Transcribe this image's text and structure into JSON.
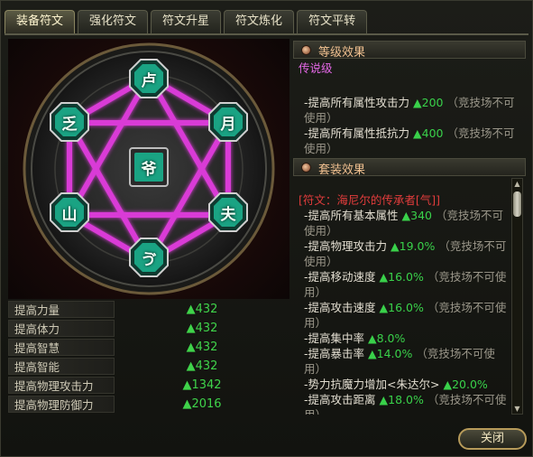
{
  "window": {
    "title": "符文"
  },
  "tabs": [
    {
      "label": "装备符文",
      "active": true
    },
    {
      "label": "强化符文",
      "active": false
    },
    {
      "label": "符文升星",
      "active": false
    },
    {
      "label": "符文炼化",
      "active": false
    },
    {
      "label": "符文平转",
      "active": false
    }
  ],
  "runes": [
    {
      "glyph": "卢"
    },
    {
      "glyph": "月"
    },
    {
      "glyph": "夫"
    },
    {
      "glyph": "ゔ"
    },
    {
      "glyph": "山"
    },
    {
      "glyph": "乏"
    },
    {
      "glyph": "爷"
    }
  ],
  "stats": [
    {
      "name": "提高力量",
      "value": "▲432"
    },
    {
      "name": "提高体力",
      "value": "▲432"
    },
    {
      "name": "提高智慧",
      "value": "▲432"
    },
    {
      "name": "提高智能",
      "value": "▲432"
    },
    {
      "name": "提高物理攻击力",
      "value": "▲1342"
    },
    {
      "name": "提高物理防御力",
      "value": "▲2016"
    }
  ],
  "level_panel": {
    "title": "等级效果",
    "grade": "传说级",
    "lines": [
      {
        "text": "-提高所有属性攻击力",
        "val": "▲200",
        "note": "（竞技场不可使用）"
      },
      {
        "text": "-提高所有属性抵抗力",
        "val": "▲400",
        "note": "（竞技场不可使用）"
      }
    ]
  },
  "set_panel": {
    "title": "套装效果",
    "set_name": "[符文：海尼尔的传承者[气]]",
    "lines": [
      {
        "text": "-提高所有基本属性",
        "val": "▲340",
        "note": "（竞技场不可使用）"
      },
      {
        "text": "-提高物理攻击力",
        "val": "▲19.0%",
        "note": "（竞技场不可使用）"
      },
      {
        "text": "-提高移动速度",
        "val": "▲16.0%",
        "note": "（竞技场不可使用）"
      },
      {
        "text": "-提高攻击速度",
        "val": "▲16.0%",
        "note": "（竞技场不可使用）"
      },
      {
        "text": "-提高集中率",
        "val": "▲8.0%",
        "note": ""
      },
      {
        "text": "-提高暴击率",
        "val": "▲14.0%",
        "note": "（竞技场不可使用）"
      },
      {
        "text": "-势力抗魔力增加<朱达尔>",
        "val": "▲20.0%",
        "note": ""
      },
      {
        "text": "-提高攻击距离",
        "val": "▲18.0%",
        "note": "（竞技场不可使用）"
      }
    ]
  },
  "close_label": "关闭",
  "colors": {
    "magenta": "#d93ad6",
    "teal": "#1aa383",
    "stat_green": "#3fd34a"
  }
}
